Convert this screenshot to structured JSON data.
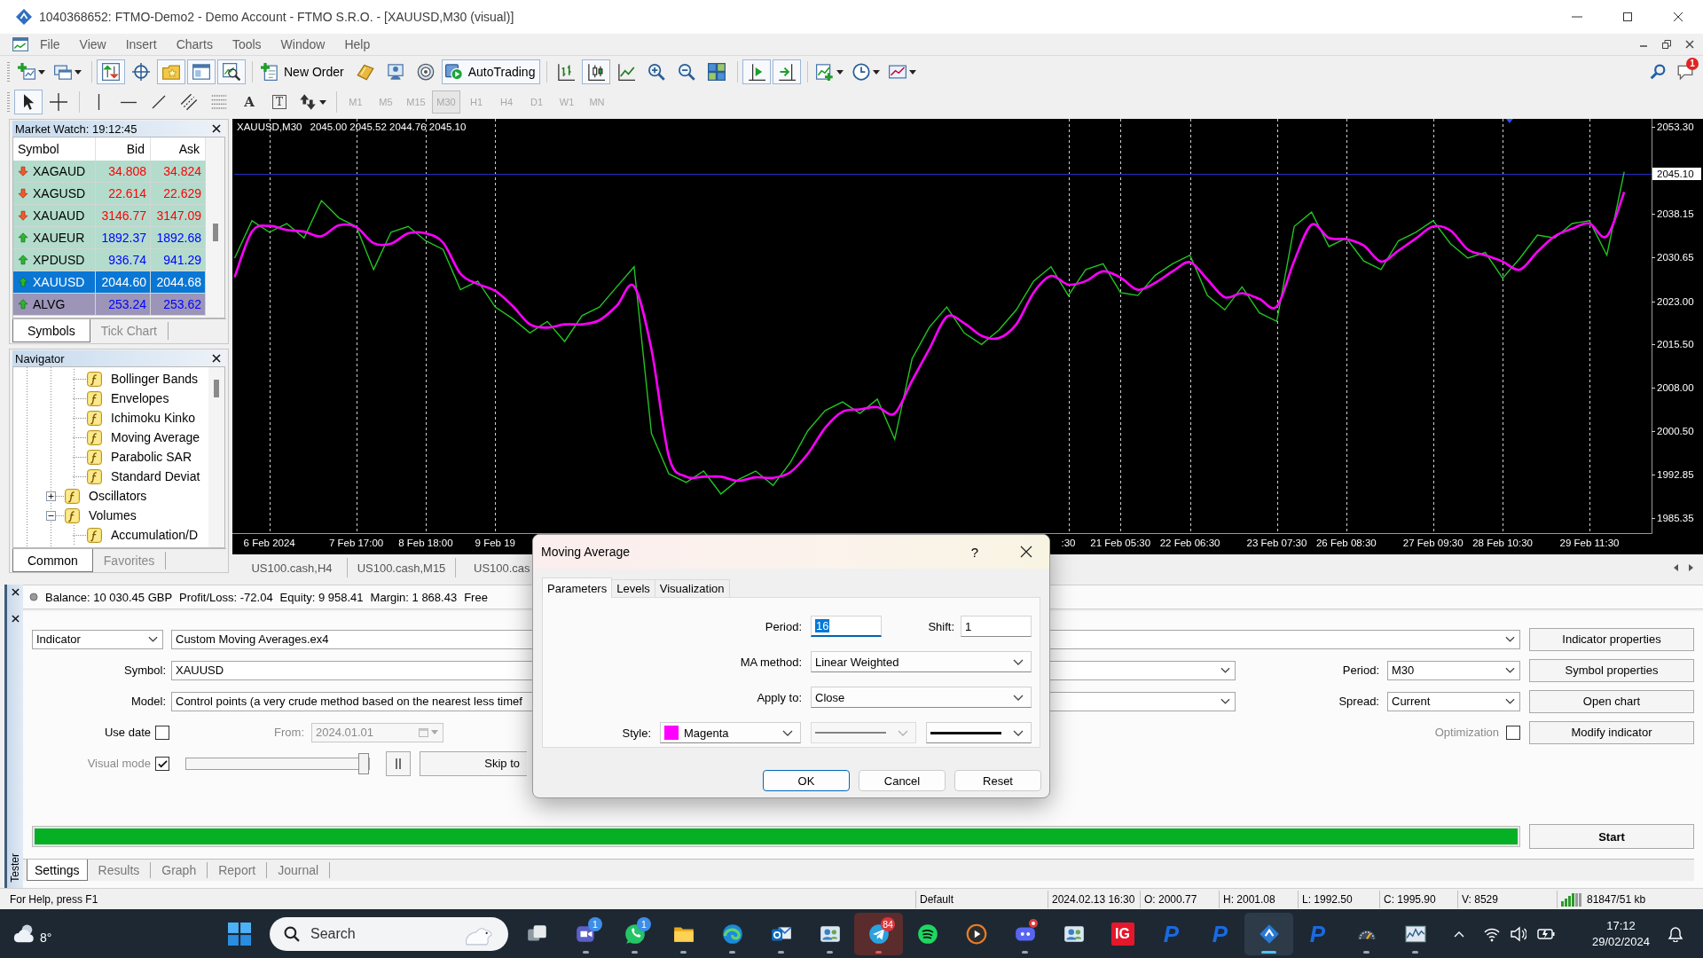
{
  "window": {
    "title": "1040368652: FTMO-Demo2 - Demo Account - FTMO S.R.O. - [XAUUSD,M30 (visual)]"
  },
  "menu": [
    "File",
    "View",
    "Insert",
    "Charts",
    "Tools",
    "Window",
    "Help"
  ],
  "toolbar": [
    {
      "kind": "new-chart",
      "menu": true,
      "pressed": false
    },
    {
      "kind": "profiles",
      "menu": true,
      "pressed": false
    },
    {
      "kind": "separator"
    },
    {
      "kind": "market-watch",
      "pressed": true
    },
    {
      "kind": "navigator",
      "pressed": false
    },
    {
      "kind": "data-window",
      "pressed": true
    },
    {
      "kind": "terminal",
      "pressed": true
    },
    {
      "kind": "tester",
      "pressed": true
    },
    {
      "kind": "separator"
    },
    {
      "kind": "new-order",
      "label": "New Order",
      "pressed": false
    },
    {
      "kind": "metaeditor",
      "pressed": false
    },
    {
      "kind": "signals",
      "pressed": false
    },
    {
      "kind": "market",
      "pressed": false
    },
    {
      "kind": "autotrading",
      "label": "AutoTrading",
      "pressed": true
    },
    {
      "kind": "separator"
    },
    {
      "kind": "bar-chart",
      "pressed": false
    },
    {
      "kind": "candles",
      "pressed": true
    },
    {
      "kind": "line-chart",
      "pressed": false
    },
    {
      "kind": "zoom-in",
      "pressed": false
    },
    {
      "kind": "zoom-out",
      "pressed": false
    },
    {
      "kind": "tile",
      "pressed": false
    },
    {
      "kind": "separator"
    },
    {
      "kind": "chart-shift",
      "pressed": true
    },
    {
      "kind": "autoscroll",
      "pressed": true
    },
    {
      "kind": "separator"
    },
    {
      "kind": "indicators",
      "menu": true,
      "pressed": false
    },
    {
      "kind": "periods",
      "menu": true,
      "pressed": false
    },
    {
      "kind": "templates",
      "menu": true,
      "pressed": false
    }
  ],
  "notifications": {
    "count": "1"
  },
  "drawing_tools": [
    {
      "kind": "cursor",
      "pressed": true
    },
    {
      "kind": "crosshair",
      "pressed": false
    },
    {
      "kind": "separator"
    },
    {
      "kind": "vline",
      "pressed": false
    },
    {
      "kind": "hline",
      "pressed": false
    },
    {
      "kind": "trendline",
      "pressed": false
    },
    {
      "kind": "channel",
      "pressed": false
    },
    {
      "kind": "fibo",
      "pressed": false
    },
    {
      "kind": "text",
      "label": "A",
      "pressed": false
    },
    {
      "kind": "text-label",
      "label": "T",
      "pressed": false
    },
    {
      "kind": "arrows",
      "menu": true,
      "pressed": false
    },
    {
      "kind": "separator"
    }
  ],
  "timeframes": [
    {
      "label": "M1",
      "selected": false,
      "disabled": true
    },
    {
      "label": "M5",
      "selected": false,
      "disabled": true
    },
    {
      "label": "M15",
      "selected": false,
      "disabled": true
    },
    {
      "label": "M30",
      "selected": true,
      "disabled": true
    },
    {
      "label": "H1",
      "selected": false,
      "disabled": true
    },
    {
      "label": "H4",
      "selected": false,
      "disabled": true
    },
    {
      "label": "D1",
      "selected": false,
      "disabled": true
    },
    {
      "label": "W1",
      "selected": false,
      "disabled": true
    },
    {
      "label": "MN",
      "selected": false,
      "disabled": true
    }
  ],
  "market_watch": {
    "title": "Market Watch: 19:12:45",
    "columns": [
      "Symbol",
      "Bid",
      "Ask"
    ],
    "rows": [
      {
        "symbol": "XAGAUD",
        "bid": "34.808",
        "ask": "34.824",
        "rising": false,
        "color": "#b3dccd",
        "selected": false
      },
      {
        "symbol": "XAGUSD",
        "bid": "22.614",
        "ask": "22.629",
        "rising": false,
        "color": "#b3dccd",
        "selected": false
      },
      {
        "symbol": "XAUAUD",
        "bid": "3146.77",
        "ask": "3147.09",
        "rising": false,
        "color": "#b3dccd",
        "selected": false
      },
      {
        "symbol": "XAUEUR",
        "bid": "1892.37",
        "ask": "1892.68",
        "rising": true,
        "color": "#b3dccd",
        "selected": false
      },
      {
        "symbol": "XPDUSD",
        "bid": "936.74",
        "ask": "941.29",
        "rising": true,
        "color": "#b3dccd",
        "selected": false
      },
      {
        "symbol": "XAUUSD",
        "bid": "2044.60",
        "ask": "2044.68",
        "rising": true,
        "selected": true
      },
      {
        "symbol": "ALVG",
        "bid": "253.24",
        "ask": "253.62",
        "rising": true,
        "color": "#9c95b8",
        "selected": false
      }
    ],
    "tabs": [
      {
        "label": "Symbols",
        "selected": true
      },
      {
        "label": "Tick Chart",
        "selected": false
      }
    ]
  },
  "navigator": {
    "title": "Navigator",
    "tree": [
      {
        "children": [
          {
            "label": "Bollinger Bands"
          },
          {
            "label": "Envelopes"
          },
          {
            "label": "Ichimoku Kinko"
          },
          {
            "label": "Moving Average"
          },
          {
            "label": "Parabolic SAR"
          },
          {
            "label": "Standard Deviat"
          }
        ]
      },
      {
        "label": "Oscillators",
        "expanded": false
      },
      {
        "label": "Volumes",
        "expanded": true,
        "children": [
          {
            "label": "Accumulation/D"
          }
        ]
      }
    ],
    "tabs": [
      {
        "label": "Common",
        "selected": true
      },
      {
        "label": "Favorites",
        "selected": false
      }
    ]
  },
  "chart": {
    "ohlc": "2045.00 2045.52 2044.76 2045.10",
    "chart_data": {
      "type": "line",
      "title": "XAUUSD,M30",
      "categories": [
        null,
        null,
        "6 Feb 2024",
        null,
        null,
        null,
        null,
        "7 Feb 17:00",
        null,
        null,
        null,
        "8 Feb 18:00",
        null,
        null,
        null,
        "9 Feb 19",
        null,
        null,
        null,
        null,
        null,
        null,
        null,
        null,
        null,
        null,
        null,
        null,
        null,
        null,
        null,
        null,
        null,
        null,
        null,
        null,
        null,
        null,
        null,
        null,
        null,
        null,
        null,
        null,
        null,
        null,
        null,
        null,
        ":30",
        null,
        null,
        "21 Feb 05:30",
        null,
        null,
        null,
        "22 Feb 06:30",
        null,
        null,
        null,
        null,
        "23 Feb 07:30",
        null,
        null,
        null,
        "26 Feb 08:30",
        null,
        null,
        null,
        null,
        "27 Feb 09:30",
        null,
        null,
        null,
        "28 Feb 10:30",
        null,
        null,
        null,
        null,
        "29 Feb 11:30",
        null,
        null
      ],
      "series": [
        {
          "color": "#22c322",
          "values": [
            2030.5,
            2037.0,
            2035.0,
            2036.5,
            2034.0,
            2040.5,
            2037.5,
            2036.0,
            2028.5,
            2035.0,
            2036.0,
            2033.5,
            2032.0,
            2025.0,
            2026.5,
            2022.0,
            2020.0,
            2017.5,
            2019.5,
            2016.0,
            2020.5,
            2022.0,
            2025.5,
            2029.0,
            2000.0,
            1993.0,
            1991.5,
            1993.5,
            1989.5,
            1992.0,
            1993.5,
            1991.0,
            1995.0,
            2000.5,
            2004.0,
            2005.5,
            2003.5,
            2006.0,
            1999.0,
            2013.0,
            2018.5,
            2022.0,
            2017.5,
            2015.5,
            2018.0,
            2021.5,
            2026.5,
            2029.0,
            2024.0,
            2028.5,
            2029.5,
            2024.5,
            2024.0,
            2027.5,
            2029.5,
            2031.0,
            2024.0,
            2021.5,
            2025.5,
            2021.0,
            2019.5,
            2036.0,
            2038.5,
            2032.5,
            2034.0,
            2030.0,
            2028.5,
            2033.5,
            2035.0,
            2037.0,
            2033.0,
            2030.5,
            2031.5,
            2027.0,
            2030.5,
            2034.5,
            2034.0,
            2036.5,
            2037.0,
            2031.0,
            2045.5
          ]
        },
        {
          "color": "#ff00ff",
          "values": [
            2027.2,
            2035.1,
            2036.1,
            2035.4,
            2035.1,
            2034.3,
            2036.2,
            2035.9,
            2033.1,
            2033.0,
            2034.8,
            2034.8,
            2033.2,
            2027.8,
            2026.0,
            2024.8,
            2022.2,
            2019.0,
            2018.4,
            2019.0,
            2019.0,
            2019.7,
            2022.2,
            2025.6,
            2014.6,
            1996.0,
            1992.5,
            1992.5,
            1992.5,
            1991.8,
            1992.4,
            1992.3,
            1993.3,
            1996.5,
            2001.0,
            2003.8,
            2004.2,
            2004.6,
            2003.5,
            2009.2,
            2014.7,
            2020.3,
            2019.2,
            2017.0,
            2016.6,
            2019.0,
            2024.5,
            2027.4,
            2025.9,
            2026.5,
            2028.2,
            2027.1,
            2025.0,
            2026.2,
            2028.2,
            2029.8,
            2026.8,
            2023.7,
            2024.4,
            2023.4,
            2022.1,
            2030.0,
            2036.3,
            2034.0,
            2033.8,
            2032.7,
            2029.9,
            2031.8,
            2033.9,
            2036.0,
            2035.3,
            2032.0,
            2031.0,
            2029.9,
            2028.5,
            2031.6,
            2034.3,
            2035.6,
            2036.5,
            2034.3,
            2042.0
          ]
        }
      ],
      "ylim": [
        1982.7,
        2054.7
      ],
      "yticks": [
        {
          "value": 2053.3,
          "label": "2053.30"
        },
        {
          "value": 2038.15,
          "label": "2038.15"
        },
        {
          "value": 2030.65,
          "label": "2030.65"
        },
        {
          "value": 2023.0,
          "label": "2023.00"
        },
        {
          "value": 2015.5,
          "label": "2015.50"
        },
        {
          "value": 2008.0,
          "label": "2008.00"
        },
        {
          "value": 2000.5,
          "label": "2000.50"
        },
        {
          "value": 1992.85,
          "label": "1992.85"
        },
        {
          "value": 1985.35,
          "label": "1985.35"
        }
      ],
      "grid": "x",
      "ref_lines": [
        {
          "value": 2045.1,
          "axis": "y",
          "label": "2045.10",
          "color": "#2b2bc4"
        }
      ]
    }
  },
  "chart_tabs": [
    {
      "label": "US100.cash,H4",
      "selected": false
    },
    {
      "label": "US100.cash,M15",
      "selected": false
    },
    {
      "label": "US100.cas",
      "selected": false
    }
  ],
  "terminal": {
    "account": [
      "Balance: 10 030.45 GBP",
      "Profit/Loss: -72.04",
      "Equity: 9 958.41",
      "Margin: 1 868.43",
      "Free"
    ]
  },
  "tester": {
    "side_label": "Tester",
    "program_type": "Indicator",
    "program": "Custom Moving Averages.ex4",
    "symbol": {
      "label": "Symbol:",
      "value": "XAUUSD"
    },
    "model": {
      "label": "Model:",
      "value": "Control points (a very crude method based on the nearest less timef"
    },
    "period": {
      "label": "Period:",
      "value": "M30"
    },
    "spread": {
      "label": "Spread:",
      "value": "Current"
    },
    "use_date": {
      "label": "Use date",
      "checked": false
    },
    "from": {
      "label": "From:",
      "value": "2024.01.01",
      "disabled": true
    },
    "optimization": {
      "label": "Optimization",
      "checked": false,
      "disabled": true
    },
    "visual_mode": {
      "label": "Visual mode",
      "checked": true,
      "disabled": true
    },
    "speed": {
      "level": 1
    },
    "skip_button": "Skip to",
    "side_buttons": [
      "Indicator properties",
      "Symbol properties",
      "Open chart",
      "Modify indicator"
    ],
    "progress": {
      "level": 1
    },
    "start_button": "Start",
    "tabs": [
      {
        "label": "Settings",
        "selected": true
      },
      {
        "label": "Results",
        "selected": false
      },
      {
        "label": "Graph",
        "selected": false
      },
      {
        "label": "Report",
        "selected": false
      },
      {
        "label": "Journal",
        "selected": false
      }
    ]
  },
  "dialog": {
    "title": "Moving Average",
    "help": "?",
    "tabs": [
      {
        "label": "Parameters",
        "selected": true
      },
      {
        "label": "Levels",
        "selected": false
      },
      {
        "label": "Visualization",
        "selected": false
      }
    ],
    "period": {
      "label": "Period:",
      "value": "16",
      "focused": true
    },
    "shift": {
      "label": "Shift:",
      "value": "1",
      "focused": false
    },
    "ma_method": {
      "label": "MA method:",
      "value": "Linear Weighted"
    },
    "apply_to": {
      "label": "Apply to:",
      "value": "Close"
    },
    "style": {
      "label": "Style:",
      "color": "#ff00ff",
      "color_name": "Magenta",
      "dashed_line": false,
      "line_style_disabled": true,
      "thick_line": true
    },
    "buttons": [
      {
        "label": "OK",
        "default": true
      },
      {
        "label": "Cancel",
        "default": false
      },
      {
        "label": "Reset",
        "default": false
      }
    ]
  },
  "status_bar": [
    {
      "kind": "text",
      "text": "For Help, press F1"
    },
    {
      "kind": "text",
      "text": "Default"
    },
    {
      "kind": "text",
      "text": "2024.02.13 16:30"
    },
    {
      "kind": "text",
      "text": "O: 2000.77"
    },
    {
      "kind": "text",
      "text": "H: 2001.08"
    },
    {
      "kind": "text",
      "text": "L: 1992.50"
    },
    {
      "kind": "text",
      "text": "C: 1995.90"
    },
    {
      "kind": "text",
      "text": "V: 8529"
    },
    {
      "kind": "connection",
      "text": "81847/51 kb"
    }
  ],
  "taskbar": {
    "weather": "8°",
    "search": {
      "placeholder": "Search"
    },
    "apps": [
      {
        "kind": "task-view",
        "running": false,
        "selected": false,
        "attention": false
      },
      {
        "kind": "video-chat",
        "badge": "1",
        "running": true,
        "selected": false,
        "attention": false
      },
      {
        "kind": "phone-chat",
        "badge": "1",
        "running": true,
        "selected": false,
        "attention": false
      },
      {
        "kind": "folder",
        "running": true,
        "selected": false,
        "attention": false
      },
      {
        "kind": "browser",
        "running": true,
        "selected": false,
        "attention": false
      },
      {
        "kind": "mail",
        "running": true,
        "selected": false,
        "attention": false
      },
      {
        "kind": "people",
        "running": true,
        "selected": false,
        "attention": false
      },
      {
        "kind": "plane",
        "badge": "84",
        "running": true,
        "selected": false,
        "attention": true
      },
      {
        "kind": "music",
        "running": false,
        "selected": false,
        "attention": false
      },
      {
        "kind": "player",
        "running": false,
        "selected": false,
        "attention": false
      },
      {
        "kind": "controller",
        "dot": true,
        "running": true,
        "selected": false,
        "attention": false
      },
      {
        "kind": "people",
        "running": false,
        "selected": false,
        "attention": false
      },
      {
        "kind": "letter-tile",
        "label": "IG",
        "color": "#e5172b",
        "running": false,
        "selected": false,
        "attention": false
      },
      {
        "kind": "letter",
        "label": "P",
        "color": "#1a6ae0",
        "running": false,
        "selected": false,
        "attention": false
      },
      {
        "kind": "letter",
        "label": "P",
        "color": "#1a6ae0",
        "running": false,
        "selected": false,
        "attention": false
      },
      {
        "kind": "diamond",
        "running": true,
        "selected": true,
        "attention": false
      },
      {
        "kind": "letter",
        "label": "P",
        "color": "#1a6ae0",
        "running": false,
        "selected": false,
        "attention": false
      },
      {
        "kind": "gauge",
        "running": true,
        "selected": false,
        "attention": false
      },
      {
        "kind": "chart",
        "running": true,
        "selected": false,
        "attention": false
      }
    ],
    "time": "17:12",
    "date": "29/02/2024"
  }
}
